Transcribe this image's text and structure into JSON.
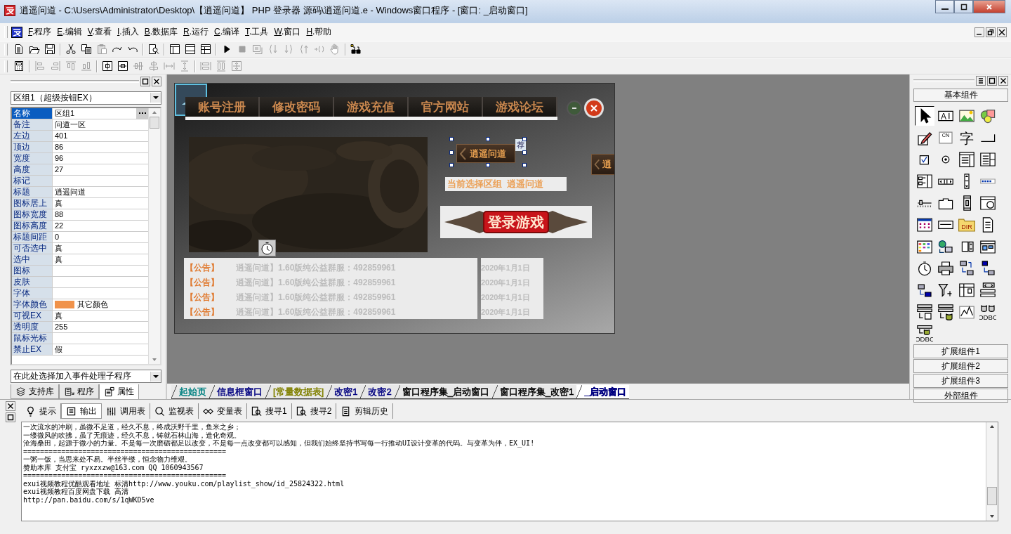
{
  "window": {
    "title": "逍遥问道 - C:\\Users\\Administrator\\Desktop\\【逍遥问道】 PHP 登录器 源码\\逍遥问道.e - Windows窗口程序 - [窗口: _启动窗口]"
  },
  "menu": [
    {
      "hotkey": "F",
      "label": ".程序"
    },
    {
      "hotkey": "E",
      "label": ".编辑"
    },
    {
      "hotkey": "V",
      "label": ".查看"
    },
    {
      "hotkey": "I",
      "label": ".插入"
    },
    {
      "hotkey": "B",
      "label": ".数据库"
    },
    {
      "hotkey": "R",
      "label": ".运行"
    },
    {
      "hotkey": "C",
      "label": ".编译"
    },
    {
      "hotkey": "T",
      "label": ".工具"
    },
    {
      "hotkey": "W",
      "label": ".窗口"
    },
    {
      "hotkey": "H",
      "label": ".帮助"
    }
  ],
  "toolbar_1": [
    {
      "kind": "new",
      "disabled": false
    },
    {
      "kind": "open",
      "disabled": false
    },
    {
      "kind": "save",
      "disabled": false
    },
    {
      "kind": "separator"
    },
    {
      "kind": "cut",
      "disabled": false
    },
    {
      "kind": "copy",
      "disabled": false
    },
    {
      "kind": "paste",
      "disabled": true
    },
    {
      "kind": "redo",
      "disabled": false
    },
    {
      "kind": "undo",
      "disabled": false
    },
    {
      "kind": "separator"
    },
    {
      "kind": "preview",
      "disabled": false
    },
    {
      "kind": "separator"
    },
    {
      "kind": "layout_a",
      "disabled": false
    },
    {
      "kind": "layout_b",
      "disabled": false
    },
    {
      "kind": "layout_c",
      "disabled": false
    },
    {
      "kind": "separator"
    },
    {
      "kind": "run",
      "disabled": false
    },
    {
      "kind": "stop",
      "disabled": true
    },
    {
      "kind": "compile",
      "disabled": true
    },
    {
      "kind": "step_into",
      "disabled": true
    },
    {
      "kind": "step_over",
      "disabled": true
    },
    {
      "kind": "step_out",
      "disabled": true
    },
    {
      "kind": "run_to",
      "disabled": true
    },
    {
      "kind": "hand",
      "disabled": true
    },
    {
      "kind": "separator"
    },
    {
      "kind": "binoculars",
      "disabled": false
    }
  ],
  "toolbar_2": [
    {
      "kind": "calculator",
      "disabled": false
    },
    {
      "kind": "separator"
    },
    {
      "kind": "align_left",
      "disabled": true
    },
    {
      "kind": "align_right",
      "disabled": true
    },
    {
      "kind": "align_top",
      "disabled": true
    },
    {
      "kind": "align_bottom",
      "disabled": true
    },
    {
      "kind": "separator"
    },
    {
      "kind": "center_h",
      "disabled": false
    },
    {
      "kind": "center_v",
      "disabled": false
    },
    {
      "kind": "align_middle",
      "disabled": true
    },
    {
      "kind": "align_center",
      "disabled": true
    },
    {
      "kind": "space_h",
      "disabled": true
    },
    {
      "kind": "space_v",
      "disabled": true
    },
    {
      "kind": "separator"
    },
    {
      "kind": "same_width",
      "disabled": true
    },
    {
      "kind": "same_height",
      "disabled": true
    },
    {
      "kind": "space_all",
      "disabled": true
    }
  ],
  "property_panel": {
    "object": "区组1（超级按钮EX）",
    "rows": [
      {
        "name": "名称",
        "value": "区组1",
        "selected": true
      },
      {
        "name": "备注",
        "value": "问道一区",
        "selected": false
      },
      {
        "name": "左边",
        "value": "401",
        "selected": false
      },
      {
        "name": "顶边",
        "value": "86",
        "selected": false
      },
      {
        "name": "宽度",
        "value": "96",
        "selected": false
      },
      {
        "name": "高度",
        "value": "27",
        "selected": false
      },
      {
        "name": "标记",
        "selected": false
      },
      {
        "name": "标题",
        "value": "逍遥问道",
        "selected": false
      },
      {
        "name": "图标居上",
        "value": "真",
        "selected": false
      },
      {
        "name": "图标宽度",
        "value": "88",
        "selected": false
      },
      {
        "name": "图标高度",
        "value": "22",
        "selected": false
      },
      {
        "name": "标题间距",
        "value": "0",
        "selected": false
      },
      {
        "name": "可否选中",
        "value": "真",
        "selected": false
      },
      {
        "name": "选中",
        "value": "真",
        "selected": false
      },
      {
        "name": "图标",
        "selected": false
      },
      {
        "name": "皮肤",
        "selected": false
      },
      {
        "name": "字体",
        "selected": false
      },
      {
        "name": "字体颜色",
        "value": "其它颜色",
        "color": "#f0924a",
        "selected": false
      },
      {
        "name": "可视EX",
        "value": "真",
        "selected": false
      },
      {
        "name": "透明度",
        "value": "255",
        "selected": false
      },
      {
        "name": "鼠标光标",
        "selected": false
      },
      {
        "name": "禁止EX",
        "value": "假",
        "selected": false
      }
    ],
    "event_selector": "在此处选择加入事件处理子程序"
  },
  "left_tabs": [
    {
      "label": "支持库",
      "kind": "library",
      "selected": false
    },
    {
      "label": "程序",
      "kind": "program",
      "selected": false
    },
    {
      "label": "属性",
      "kind": "properties",
      "selected": true
    }
  ],
  "designer": {
    "nav_buttons": [
      "账号注册",
      "修改密码",
      "游戏充值",
      "官方网站",
      "游戏论坛"
    ],
    "server_button": {
      "label": "逍遥问道",
      "badge": "荐",
      "selected": true
    },
    "second_server_button": {
      "label": "逍"
    },
    "status_label": "当前选择区组  逍遥问道",
    "login_button": "登录游戏",
    "notices": [
      {
        "tag": "【公告】",
        "text": "逍遥问道】1.60版纯公益群服：492859961",
        "date": "2020年1月1日"
      },
      {
        "tag": "【公告】",
        "text": "逍遥问道】1.60版纯公益群服：492859961",
        "date": "2020年1月1日"
      },
      {
        "tag": "【公告】",
        "text": "逍遥问道】1.60版纯公益群服：492859961",
        "date": "2020年1月1日"
      },
      {
        "tag": "【公告】",
        "text": "逍遥问道】1.60版纯公益群服：492859961",
        "date": "2020年1月1日"
      }
    ]
  },
  "doc_tabs": [
    {
      "label": "起始页",
      "color": "#008080",
      "selected": false
    },
    {
      "label": "信息框窗口",
      "color": "#000080",
      "selected": false
    },
    {
      "label": "[常量数据表]",
      "color": "#808000",
      "selected": false
    },
    {
      "label": "改密1",
      "color": "#000080",
      "selected": false
    },
    {
      "label": "改密2",
      "color": "#000080",
      "selected": false
    },
    {
      "label": "窗口程序集_启动窗口",
      "color": "#000000",
      "selected": false
    },
    {
      "label": "窗口程序集_改密1",
      "color": "#000000",
      "selected": false
    },
    {
      "label": "_启动窗口",
      "color": "#000080",
      "selected": true
    }
  ],
  "palette": {
    "header": "基本组件",
    "items": [
      {
        "kind": "pointer",
        "selected": true
      },
      {
        "kind": "label",
        "label": "A",
        "selected": false
      },
      {
        "kind": "picture",
        "selected": false
      },
      {
        "kind": "shapes",
        "selected": false
      },
      {
        "kind": "edit",
        "selected": false
      },
      {
        "kind": "cn",
        "label": "CN",
        "selected": false
      },
      {
        "kind": "char",
        "label": "字",
        "selected": false
      },
      {
        "kind": "button",
        "selected": false
      },
      {
        "kind": "checkbox",
        "selected": false
      },
      {
        "kind": "radio",
        "selected": false
      },
      {
        "kind": "combo",
        "selected": false
      },
      {
        "kind": "listbox",
        "selected": false
      },
      {
        "kind": "listview",
        "selected": false
      },
      {
        "kind": "hscroll",
        "selected": false
      },
      {
        "kind": "vscroll",
        "selected": false
      },
      {
        "kind": "progress",
        "selected": false
      },
      {
        "kind": "slider",
        "selected": false
      },
      {
        "kind": "tab",
        "selected": false
      },
      {
        "kind": "anim",
        "selected": false
      },
      {
        "kind": "window",
        "selected": false
      },
      {
        "kind": "calendar",
        "selected": false
      },
      {
        "kind": "frame",
        "selected": false
      },
      {
        "kind": "dir",
        "label": "DIR",
        "selected": false
      },
      {
        "kind": "doc",
        "selected": false
      },
      {
        "kind": "colorgrid",
        "selected": false
      },
      {
        "kind": "netcomp",
        "selected": false
      },
      {
        "kind": "spin",
        "selected": false
      },
      {
        "kind": "toolwin",
        "selected": false
      },
      {
        "kind": "timer",
        "selected": false
      },
      {
        "kind": "printer",
        "selected": false
      },
      {
        "kind": "srv_a",
        "selected": false
      },
      {
        "kind": "srv_b",
        "selected": false
      },
      {
        "kind": "srv_c",
        "selected": false
      },
      {
        "kind": "funnel",
        "selected": false
      },
      {
        "kind": "table",
        "selected": false
      },
      {
        "kind": "nav",
        "selected": false
      },
      {
        "kind": "db_list",
        "selected": false
      },
      {
        "kind": "db_cyl",
        "selected": false
      },
      {
        "kind": "chart",
        "selected": false
      },
      {
        "kind": "odbc",
        "label": "ODBC",
        "selected": false
      },
      {
        "kind": "odbc_list",
        "label": "ODBC",
        "selected": false
      }
    ],
    "groups": [
      "扩展组件1",
      "扩展组件2",
      "扩展组件3",
      "外部组件"
    ]
  },
  "output_tabs": [
    {
      "label": "提示",
      "kind": "hint",
      "selected": false
    },
    {
      "label": "输出",
      "kind": "output",
      "selected": true
    },
    {
      "label": "调用表",
      "kind": "calls",
      "selected": false
    },
    {
      "label": "监视表",
      "kind": "watch",
      "selected": false
    },
    {
      "label": "变量表",
      "kind": "vars",
      "selected": false
    },
    {
      "label": "搜寻1",
      "kind": "search",
      "selected": false
    },
    {
      "label": "搜寻2",
      "kind": "search",
      "selected": false
    },
    {
      "label": "剪辑历史",
      "kind": "clip",
      "selected": false
    }
  ],
  "output_lines": [
    "一次流水的冲刷，虽微不足道，经久不息，终成沃野千里，鱼米之乡；",
    "一缕微风的吹拂，虽了无痕迹，经久不息，铸就石林山海，造化奇观。",
    "沧海桑田，起源于微小的力量。不是每一次磨砺都足以改变，不是每一点改变都可以感知，但我们始终坚持书写每一行推动UI设计变革的代码。与变革为伴，EX_UI!",
    "================================================",
    "一粥一饭，当思来处不易。半丝半缕，恒念物力维艰。",
    "赞助本库 支付宝 ryxzxzw@163.com QQ 1060943567",
    "================================================",
    "exui视频教程优酷观看地址 标清http://www.youku.com/playlist_show/id_25824322.html",
    "exui视频教程百度网盘下载 高清",
    "http://pan.baidu.com/s/1qWKD5ve"
  ]
}
